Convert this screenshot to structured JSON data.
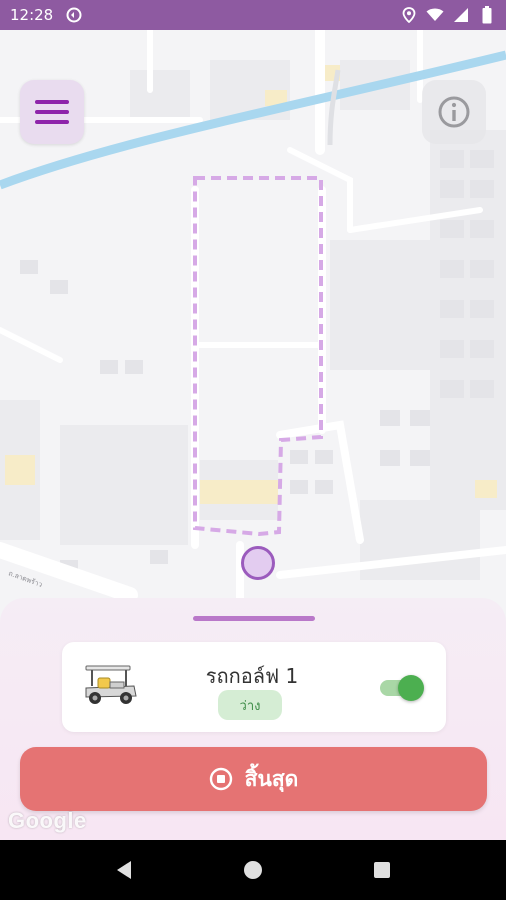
{
  "status_bar": {
    "time": "12:28",
    "icons": [
      "sync-icon",
      "location-icon",
      "wifi-icon",
      "signal-icon",
      "battery-icon"
    ]
  },
  "map": {
    "menu_icon": "hamburger-menu-icon",
    "info_icon": "info-icon",
    "route_color": "#d5a8e6",
    "pin_color": "#9b5bbd",
    "attribution": "Google",
    "street_label": "ถ.ลาดพร้าว"
  },
  "sheet": {
    "vehicle": {
      "name": "รถกอล์ฟ 1",
      "status": "ว่าง",
      "icon": "golf-cart-icon",
      "toggle_on": true
    },
    "end_button": {
      "label": "สิ้นสุด",
      "icon": "stop-circle-icon",
      "color": "#e57373"
    }
  },
  "nav_bar": {
    "icons": [
      "back-icon",
      "home-icon",
      "recents-icon"
    ]
  }
}
